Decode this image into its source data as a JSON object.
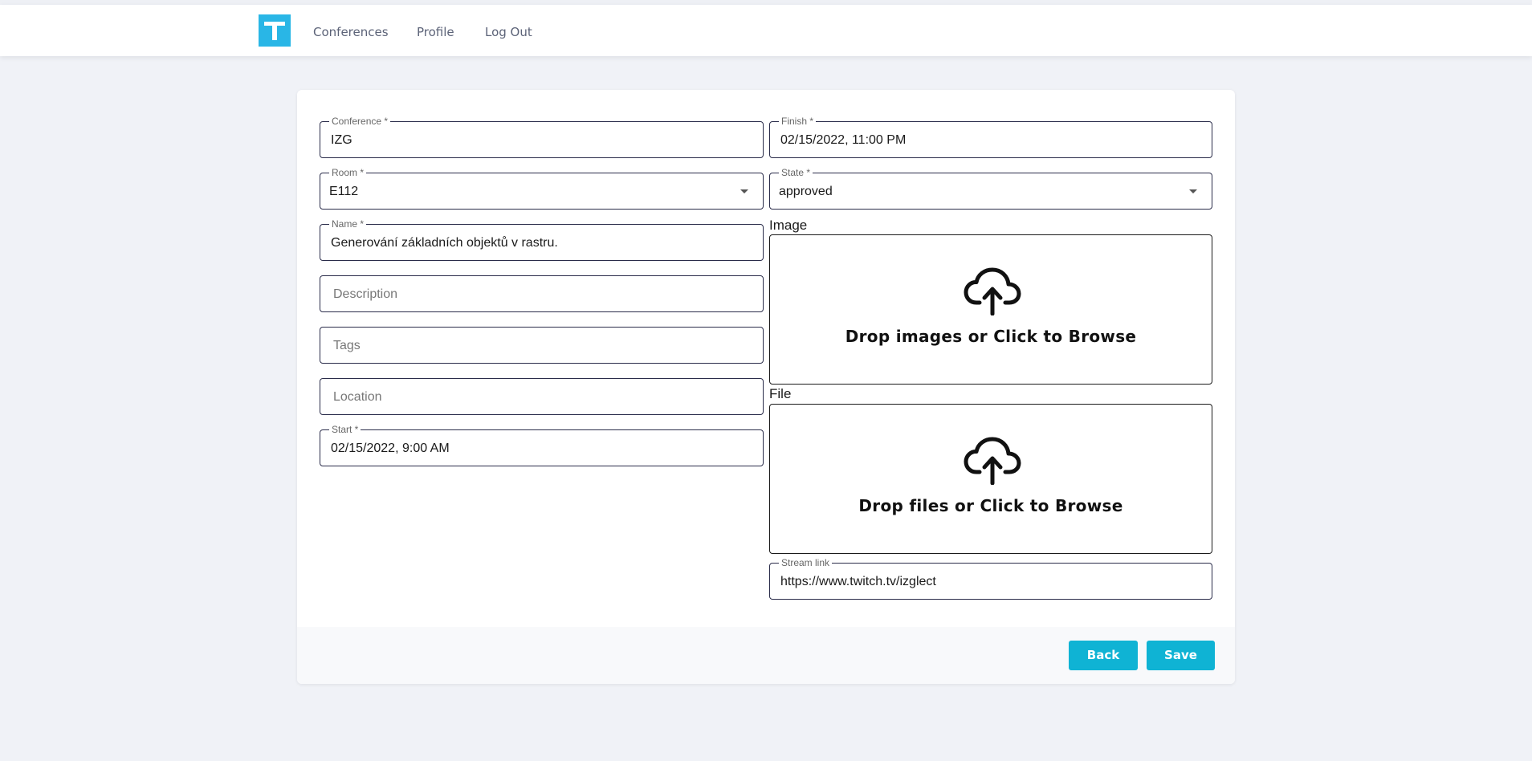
{
  "nav": {
    "logo_letter": "T",
    "links": [
      "Conferences",
      "Profile",
      "Log Out"
    ]
  },
  "form": {
    "conference": {
      "label": "Conference *",
      "value": "IZG"
    },
    "room": {
      "label": "Room *",
      "value": "E112"
    },
    "name": {
      "label": "Name *",
      "value": "Generování základních objektů v rastru."
    },
    "description": {
      "placeholder": "Description"
    },
    "tags": {
      "placeholder": "Tags"
    },
    "location": {
      "placeholder": "Location"
    },
    "start": {
      "label": "Start *",
      "value": "02/15/2022, 9:00 AM"
    },
    "finish": {
      "label": "Finish *",
      "value": "02/15/2022, 11:00 PM"
    },
    "state": {
      "label": "State *",
      "value": "approved"
    },
    "image": {
      "label": "Image",
      "drop_text": "Drop images or Click to Browse"
    },
    "file": {
      "label": "File",
      "drop_text": "Drop files or Click to Browse"
    },
    "stream_link": {
      "label": "Stream link",
      "value": "https://www.twitch.tv/izglect"
    }
  },
  "actions": {
    "back_label": "Back",
    "save_label": "Save"
  },
  "colors": {
    "accent": "#0fb3d4",
    "logo": "#29b6e6",
    "background": "#f0f2f7"
  },
  "icons": {
    "dropzone": "cloud-upload-icon",
    "select": "chevron-down-icon"
  }
}
